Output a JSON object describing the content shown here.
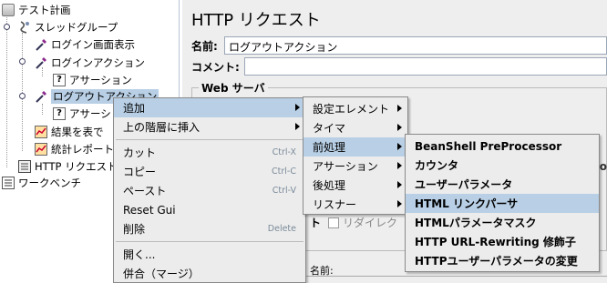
{
  "tree": {
    "items": [
      {
        "label": "テスト計画"
      },
      {
        "label": "スレッドグループ"
      },
      {
        "label": "ログイン画面表示"
      },
      {
        "label": "ログインアクション"
      },
      {
        "label": "アサーション"
      },
      {
        "label": "ログアウトアクション"
      },
      {
        "label": "アサーシ"
      },
      {
        "label": "結果を表で"
      },
      {
        "label": "統計レポート"
      },
      {
        "label": "HTTP リクエスト"
      },
      {
        "label": "ワークベンチ"
      }
    ]
  },
  "panel": {
    "title": "HTTP リクエスト",
    "name_label": "名前:",
    "name_value": "ログアウトアクション",
    "comment_label": "コメント:",
    "web_server_label": "Web サーバ",
    "redirect_label": "リダイレク",
    "co_fragment": "co",
    "t_fragment": "ト",
    "bottom_name_label": "名前:"
  },
  "context_menu": {
    "items": [
      {
        "label": "追加",
        "submenu": true
      },
      {
        "label": "上の階層に挿入",
        "submenu": true
      },
      {
        "label": "カット",
        "accel": "Ctrl-X"
      },
      {
        "label": "コピー",
        "accel": "Ctrl-C"
      },
      {
        "label": "ペースト",
        "accel": "Ctrl-V"
      },
      {
        "label": "Reset Gui"
      },
      {
        "label": "削除",
        "accel": "Delete"
      },
      {
        "label": "開く..."
      },
      {
        "label": "併合（マージ）"
      }
    ]
  },
  "add_menu": {
    "items": [
      {
        "label": "設定エレメント"
      },
      {
        "label": "タイマ"
      },
      {
        "label": "前処理"
      },
      {
        "label": "アサーション"
      },
      {
        "label": "後処理"
      },
      {
        "label": "リスナー"
      }
    ]
  },
  "preprocessor_menu": {
    "items": [
      {
        "label": "BeanShell PreProcessor"
      },
      {
        "label": "カウンタ"
      },
      {
        "label": "ユーザーパラメータ"
      },
      {
        "label": "HTML リンクパーサ"
      },
      {
        "label": "HTMLパラメータマスク"
      },
      {
        "label": "HTTP URL-Rewriting 修飾子"
      },
      {
        "label": "HTTPユーザーパラメータの変更"
      }
    ]
  },
  "colors": {
    "highlight": "#b8cfe5",
    "menu_bg": "#ececec",
    "panel_bg": "#eeeeee"
  }
}
